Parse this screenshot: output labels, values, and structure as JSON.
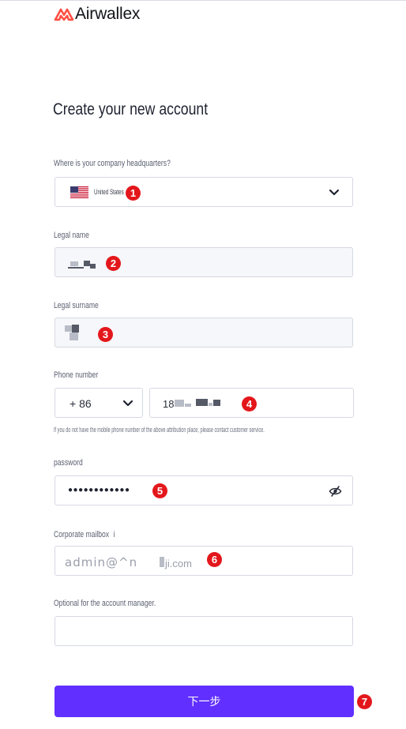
{
  "brand": {
    "name": "Airwallex",
    "logo_color": "#ff4f42"
  },
  "form": {
    "title": "Create your new account",
    "hq": {
      "label": "Where is your company headquarters?",
      "value": "United States",
      "flag": "us-flag-icon"
    },
    "legal_name": {
      "label": "Legal name"
    },
    "legal_surname": {
      "label": "Legal surname"
    },
    "phone": {
      "label": "Phone number",
      "country_code": "+ 86",
      "number_prefix": "18",
      "hint": "If you do not have the mobile phone number of the above attribution place, please contact customer service."
    },
    "password": {
      "label": "password",
      "masked_value": "●●●●●●●●●●●●",
      "toggle_icon": "eye-off-icon"
    },
    "mailbox": {
      "label": "Corporate mailbox",
      "info_marker": "i",
      "value": "admin@^n",
      "value_tail": "ji.com"
    },
    "account_manager": {
      "label": "Optional for the account manager."
    },
    "submit_label": "下一步"
  },
  "annotations": [
    "1",
    "2",
    "3",
    "4",
    "5",
    "6",
    "7"
  ],
  "colors": {
    "primary": "#612fff",
    "annotation": "#e3171b",
    "field_border": "#d6d9e2"
  }
}
